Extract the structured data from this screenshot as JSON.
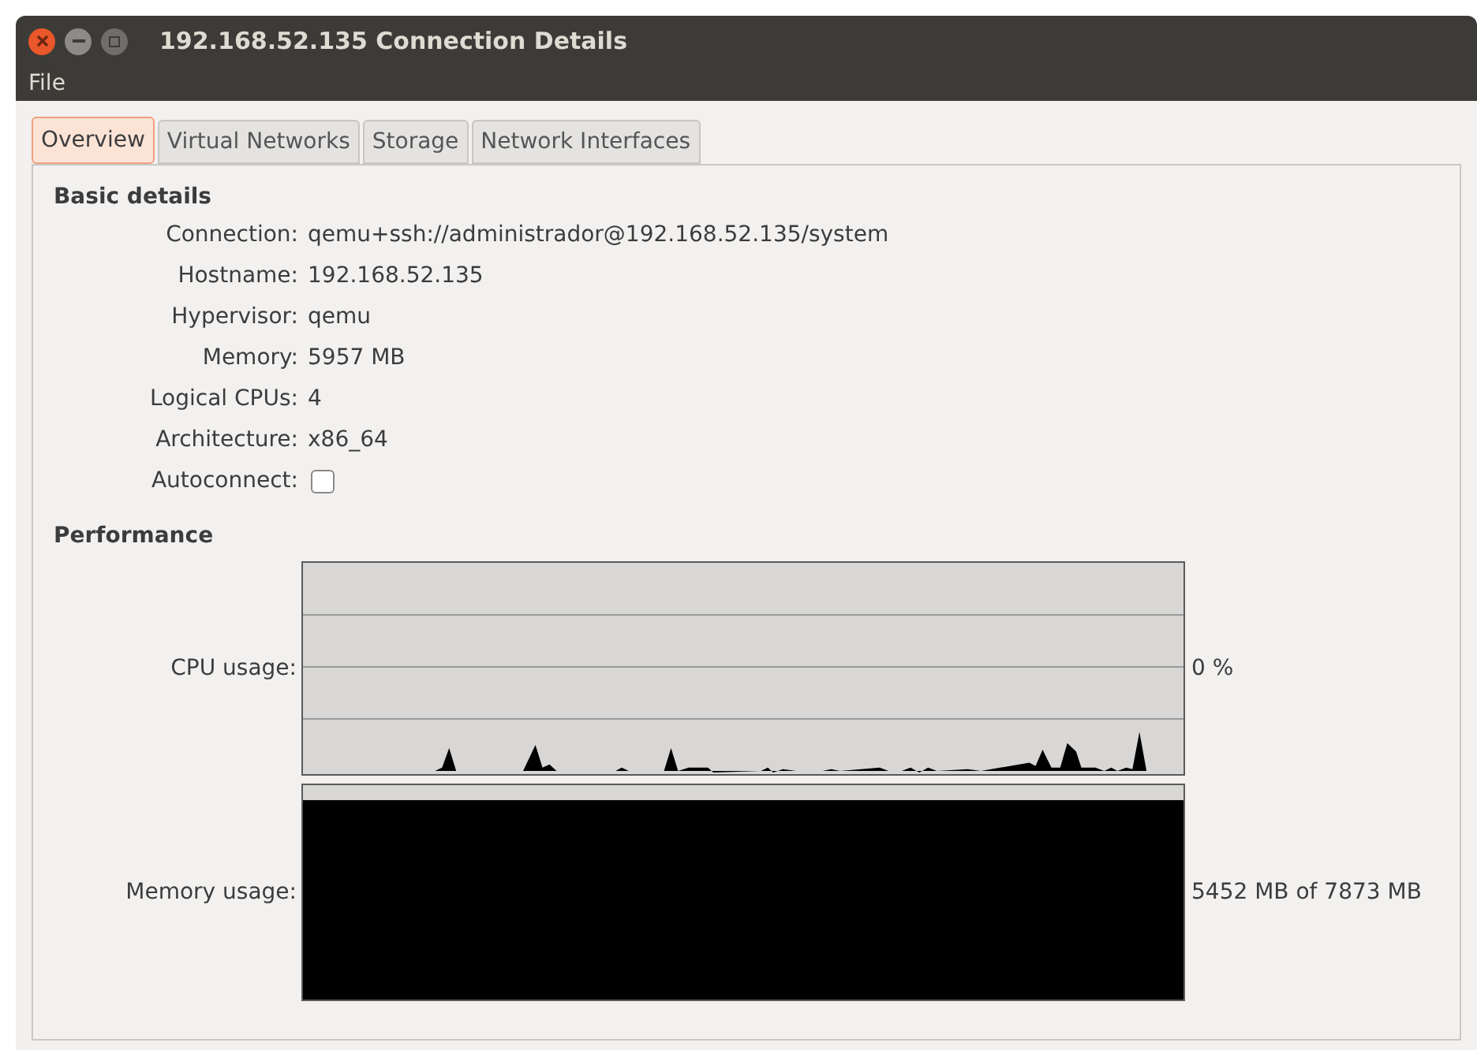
{
  "window": {
    "title": "192.168.52.135 Connection Details"
  },
  "menu": [
    "File"
  ],
  "tabs": [
    {
      "label": "Overview",
      "selected": true
    },
    {
      "label": "Virtual Networks",
      "selected": false
    },
    {
      "label": "Storage",
      "selected": false
    },
    {
      "label": "Network Interfaces",
      "selected": false
    }
  ],
  "basic_details": {
    "heading": "Basic details",
    "rows": [
      {
        "kind": "text",
        "label": "Connection:",
        "value": "qemu+ssh://administrador@192.168.52.135/system"
      },
      {
        "kind": "text",
        "label": "Hostname:",
        "value": "192.168.52.135"
      },
      {
        "kind": "text",
        "label": "Hypervisor:",
        "value": "qemu"
      },
      {
        "kind": "text",
        "label": "Memory:",
        "value": "5957 MB"
      },
      {
        "kind": "text",
        "label": "Logical CPUs:",
        "value": "4"
      },
      {
        "kind": "text",
        "label": "Architecture:",
        "value": "x86_64"
      },
      {
        "kind": "checkbox",
        "label": "Autoconnect:",
        "checked": false
      }
    ]
  },
  "performance": {
    "heading": "Performance",
    "graphs": [
      {
        "kind": "cpu",
        "label": "CPU usage:",
        "reading": "0 %"
      },
      {
        "kind": "memory",
        "label": "Memory usage:",
        "reading": "5452 MB of 7873 MB"
      }
    ]
  }
}
